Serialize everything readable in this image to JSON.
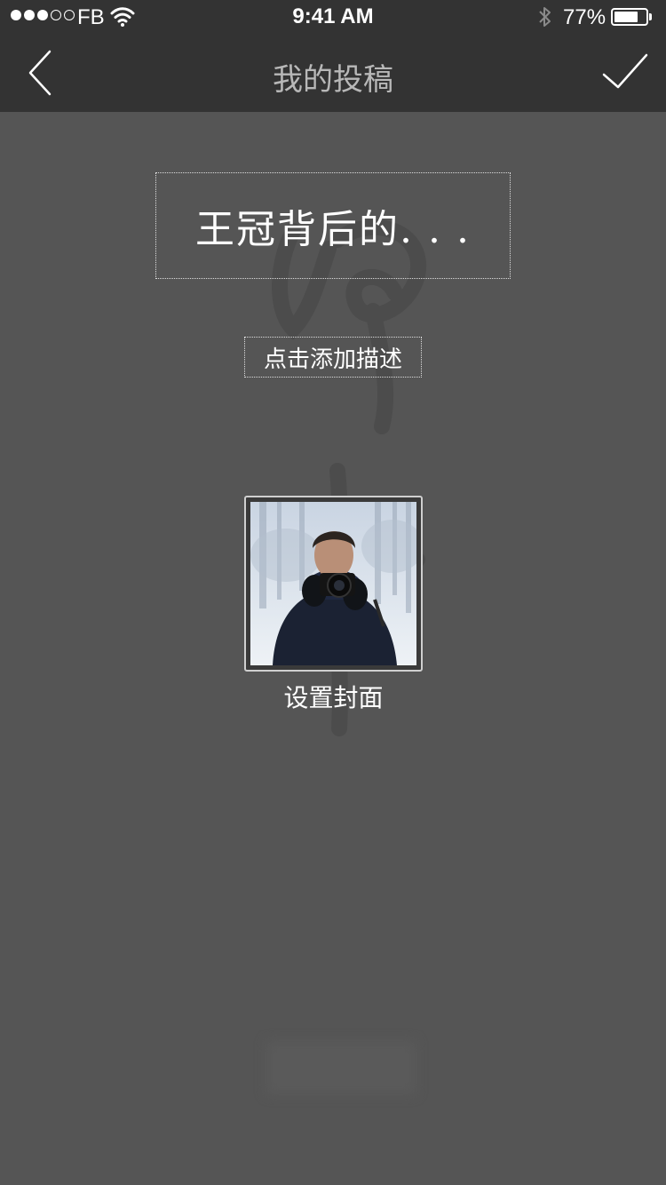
{
  "status_bar": {
    "carrier": "FB",
    "time": "9:41 AM",
    "battery_percent": "77%",
    "battery_level": 0.77,
    "signal_bars_filled": 3,
    "signal_bars_total": 5
  },
  "nav": {
    "title": "我的投稿",
    "back_icon": "chevron-left-icon",
    "done_icon": "checkmark-icon"
  },
  "editor": {
    "title_text": "王冠背后的. . .",
    "description_placeholder": "点击添加描述",
    "cover_label": "设置封面"
  },
  "colors": {
    "background": "#555555",
    "bar": "#333333",
    "nav_title": "#b8b8b8",
    "text": "#ffffff"
  }
}
